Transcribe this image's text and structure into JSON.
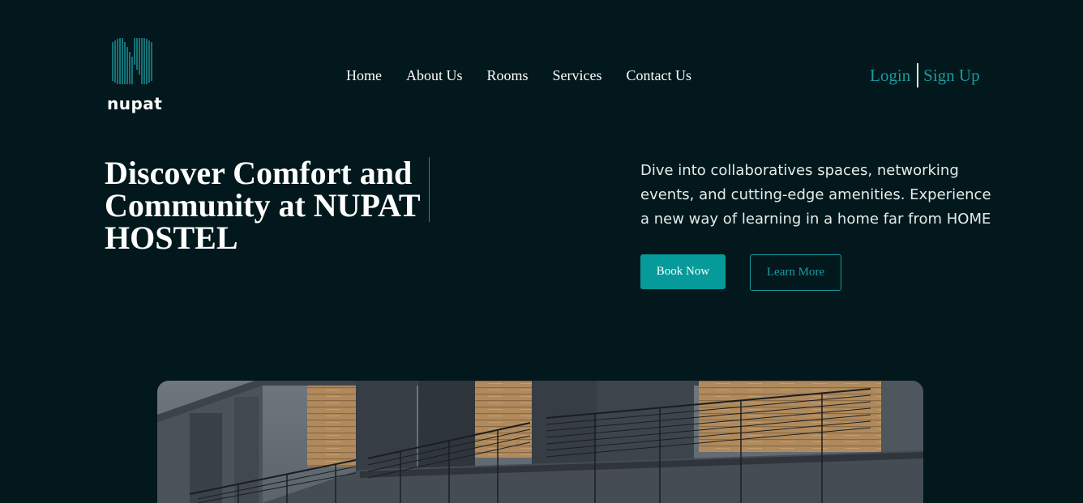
{
  "brand": {
    "name": "nupat",
    "accent": "#1c9aa0",
    "background": "#02181c"
  },
  "nav": {
    "items": [
      {
        "label": "Home"
      },
      {
        "label": "About Us"
      },
      {
        "label": "Rooms"
      },
      {
        "label": "Services"
      },
      {
        "label": "Contact Us"
      }
    ]
  },
  "auth": {
    "login": "Login",
    "signup": "Sign Up"
  },
  "hero": {
    "title": "Discover Comfort and Community at NUPAT HOSTEL",
    "description": "Dive into collaboratives spaces, networking events, and cutting-edge amenities. Experience a new way of learning in a home far from HOME",
    "book_label": "Book Now",
    "learn_label": "Learn More",
    "image_icon": "hostel-building-image"
  }
}
